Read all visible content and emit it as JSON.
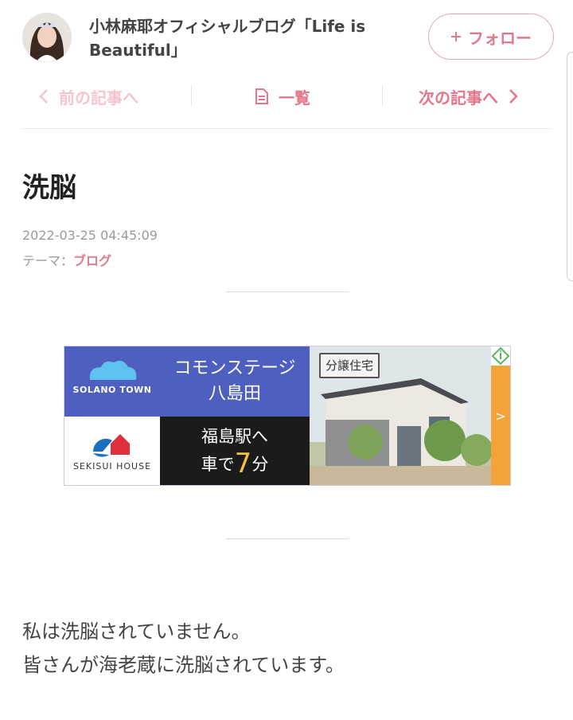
{
  "header": {
    "blog_title": "小林麻耶オフィシャルブログ「Life is Beautiful」",
    "avatar_icon": "blogger-avatar",
    "follow_label": "フォロー",
    "follow_icon": "plus-icon",
    "accent_color": "#e0798a"
  },
  "nav": {
    "prev_label": "前の記事へ",
    "list_label": "一覧",
    "next_label": "次の記事へ"
  },
  "entry": {
    "title": "洗脳",
    "date": "2022-03-25 04:45:09",
    "theme_label": "テーマ：",
    "theme_value": "ブログ"
  },
  "ad": {
    "brand": "SOLANO TOWN",
    "sub_brand": "SEKISUI HOUSE",
    "headline_1": "コモンステージ",
    "headline_2": "八島田",
    "line_1": "福島駅へ",
    "line_2_prefix": "車で",
    "line_2_number": "7",
    "line_2_suffix": "分",
    "badge": "分譲住宅",
    "arrow": ">"
  },
  "body": {
    "line_1": "私は洗脳されていません。",
    "line_2": "皆さんが海老蔵に洗脳されています。"
  }
}
